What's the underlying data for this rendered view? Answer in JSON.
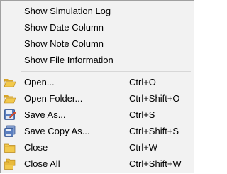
{
  "menu": {
    "view_items": [
      {
        "label": "Show Simulation Log"
      },
      {
        "label": "Show Date Column"
      },
      {
        "label": "Show Note Column"
      },
      {
        "label": "Show File Information"
      }
    ],
    "file_items": [
      {
        "label": "Open...",
        "shortcut": "Ctrl+O",
        "icon": "open-folder-icon"
      },
      {
        "label": "Open Folder...",
        "shortcut": "Ctrl+Shift+O",
        "icon": "open-folder-icon"
      },
      {
        "label": "Save As...",
        "shortcut": "Ctrl+S",
        "icon": "save-as-icon"
      },
      {
        "label": "Save Copy As...",
        "shortcut": "Ctrl+Shift+S",
        "icon": "save-copy-icon"
      },
      {
        "label": "Close",
        "shortcut": "Ctrl+W",
        "icon": "close-folder-icon"
      },
      {
        "label": "Close All",
        "shortcut": "Ctrl+Shift+W",
        "icon": "close-all-icon"
      }
    ]
  },
  "colors": {
    "menu_background": "#f2f2f2",
    "menu_border": "#a0a0a0",
    "separator": "#d7d7d7",
    "folder_yellow": "#f2c94c",
    "disk_blue": "#5b7fbf"
  }
}
